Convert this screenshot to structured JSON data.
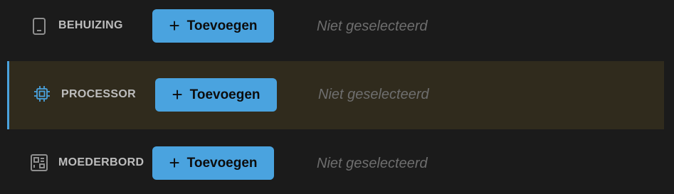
{
  "components": [
    {
      "id": "behuizing",
      "label": "BEHUIZING",
      "icon": "case-icon",
      "add_label": "Toevoegen",
      "status": "Niet geselecteerd",
      "selected": false
    },
    {
      "id": "processor",
      "label": "PROCESSOR",
      "icon": "cpu-icon",
      "add_label": "Toevoegen",
      "status": "Niet geselecteerd",
      "selected": false,
      "highlighted": true
    },
    {
      "id": "moederbord",
      "label": "MOEDERBORD",
      "icon": "motherboard-icon",
      "add_label": "Toevoegen",
      "status": "Niet geselecteerd",
      "selected": false
    }
  ],
  "colors": {
    "background": "#1b1b1b",
    "accent": "#4aa3df",
    "highlight_row": "#302b1d",
    "label": "#bdbdbd",
    "muted": "#6e6e6e"
  }
}
